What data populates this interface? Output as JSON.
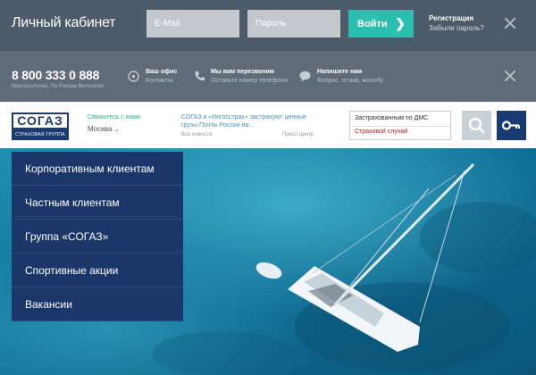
{
  "login": {
    "title": "Личный кабинет",
    "email_placeholder": "E-Mail",
    "password_placeholder": "Пароль",
    "submit_label": "Войти",
    "register_label": "Регистрация",
    "forgot_label": "Забыли пароль?"
  },
  "contact": {
    "phone": "8 800 333 0 888",
    "phone_sub": "Круглосуточно. По России бесплатно",
    "office_title": "Ваш офис",
    "office_sub": "Контакты",
    "callback_title": "Мы вам перезвоним",
    "callback_sub": "Оставьте номер телефона",
    "write_title": "Напишите нам",
    "write_sub": "Вопрос, отзыв, жалобу"
  },
  "header": {
    "logo_text": "СОГАЗ",
    "logo_sub": "СТРАХОВАЯ ГРУППА",
    "contact_us": "Свяжитесь с нами",
    "city": "Москва",
    "news_text": "СОГАЗ и «Ингосстрах» застрахуют ценные грузы Почты России на...",
    "news_all": "Все новости",
    "press": "Пресс-центр",
    "insured_select": "Застрахованным по ДМС",
    "insured_case": "Страховой случай"
  },
  "menu": {
    "items": [
      "Корпоративным клиентам",
      "Частным клиентам",
      "Группа «СОГАЗ»",
      "Спортивные акции",
      "Вакансии"
    ]
  },
  "colors": {
    "login_bg": "#4c5a6a",
    "contact_bg": "#5f6b78",
    "accent": "#2bbfb0",
    "brand": "#1a3b72"
  }
}
